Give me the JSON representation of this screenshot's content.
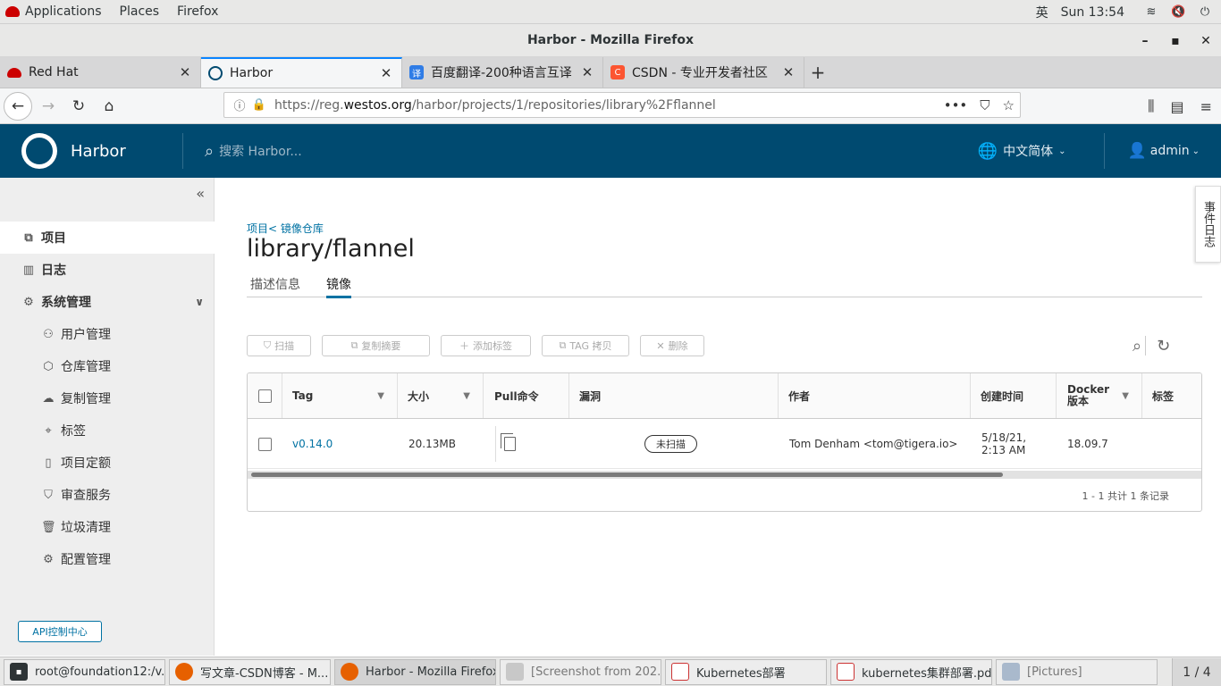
{
  "gnome": {
    "applications": "Applications",
    "places": "Places",
    "firefox": "Firefox",
    "input_method": "英",
    "clock": "Sun 13:54"
  },
  "window": {
    "title": "Harbor - Mozilla Firefox"
  },
  "tabs": [
    {
      "label": "Red Hat"
    },
    {
      "label": "Harbor"
    },
    {
      "label": "百度翻译-200种语言互译"
    },
    {
      "label": "CSDN - 专业开发者社区"
    }
  ],
  "url": {
    "prefix": "https://reg.",
    "domain": "westos.org",
    "path": "/harbor/projects/1/repositories/library%2Fflannel"
  },
  "harbor": {
    "name": "Harbor",
    "search_placeholder": "搜索 Harbor...",
    "language": "中文简体",
    "user": "admin"
  },
  "sidebar": {
    "top_items": [
      {
        "label": "项目"
      },
      {
        "label": "日志"
      },
      {
        "label": "系统管理"
      }
    ],
    "sub_items": [
      {
        "label": "用户管理"
      },
      {
        "label": "仓库管理"
      },
      {
        "label": "复制管理"
      },
      {
        "label": "标签"
      },
      {
        "label": "项目定额"
      },
      {
        "label": "审查服务"
      },
      {
        "label": "垃圾清理"
      },
      {
        "label": "配置管理"
      }
    ],
    "api_button": "API控制中心"
  },
  "main": {
    "breadcrumb": "项目< 镜像仓库",
    "title": "library/flannel",
    "tabs": [
      {
        "label": "描述信息"
      },
      {
        "label": "镜像"
      }
    ],
    "event_log": "事件日志",
    "toolbar": {
      "scan": "扫描",
      "copy_digest": "复制摘要",
      "add_label": "添加标签",
      "tag_copy": "TAG 拷贝",
      "delete": "删除"
    },
    "columns": [
      "Tag",
      "大小",
      "Pull命令",
      "漏洞",
      "作者",
      "创建时间",
      "Docker 版本",
      "标签"
    ],
    "rows": [
      {
        "tag": "v0.14.0",
        "size": "20.13MB",
        "vuln": "未扫描",
        "author": "Tom Denham <tom@tigera.io>",
        "created_date": "5/18/21,",
        "created_time": "2:13 AM",
        "docker": "18.09.7"
      }
    ],
    "footer": "1 - 1 共计 1 条记录"
  },
  "taskbar": {
    "items": [
      {
        "label": "root@foundation12:/v..."
      },
      {
        "label": "写文章-CSDN博客 - M..."
      },
      {
        "label": "Harbor - Mozilla Firefox"
      },
      {
        "label": "[Screenshot from 202..."
      },
      {
        "label": "Kubernetes部署"
      },
      {
        "label": "kubernetes集群部署.pdf"
      },
      {
        "label": "[Pictures]"
      }
    ],
    "pager": "1 / 4"
  }
}
